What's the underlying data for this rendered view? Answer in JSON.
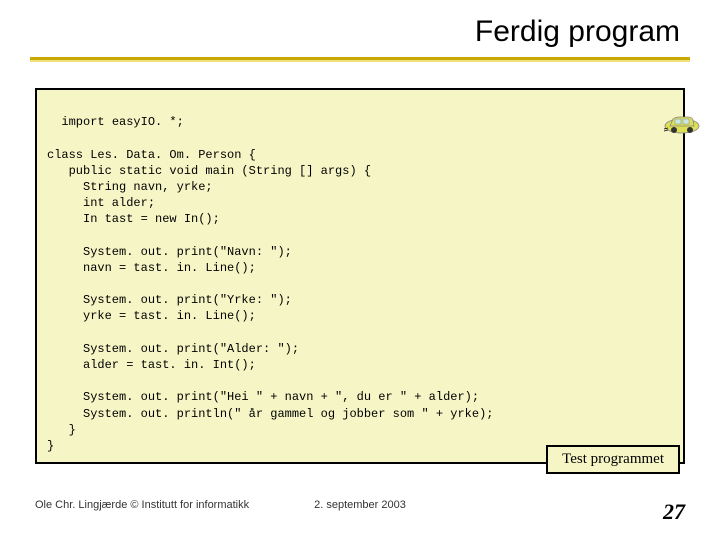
{
  "title": "Ferdig program",
  "code": "import easyIO. *;\n\nclass Les. Data. Om. Person {\n   public static void main (String [] args) {\n     String navn, yrke;\n     int alder;\n     In tast = new In();\n\n     System. out. print(\"Navn: \");\n     navn = tast. in. Line();\n\n     System. out. print(\"Yrke: \");\n     yrke = tast. in. Line();\n\n     System. out. print(\"Alder: \");\n     alder = tast. in. Int();\n\n     System. out. print(\"Hei \" + navn + \", du er \" + alder);\n     System. out. println(\" år gammel og jobber som \" + yrke);\n   }\n}",
  "button_label": "Test programmet",
  "footer": {
    "left": "Ole Chr. Lingjærde © Institutt for informatikk",
    "center": "2. september 2003",
    "right": "27"
  }
}
